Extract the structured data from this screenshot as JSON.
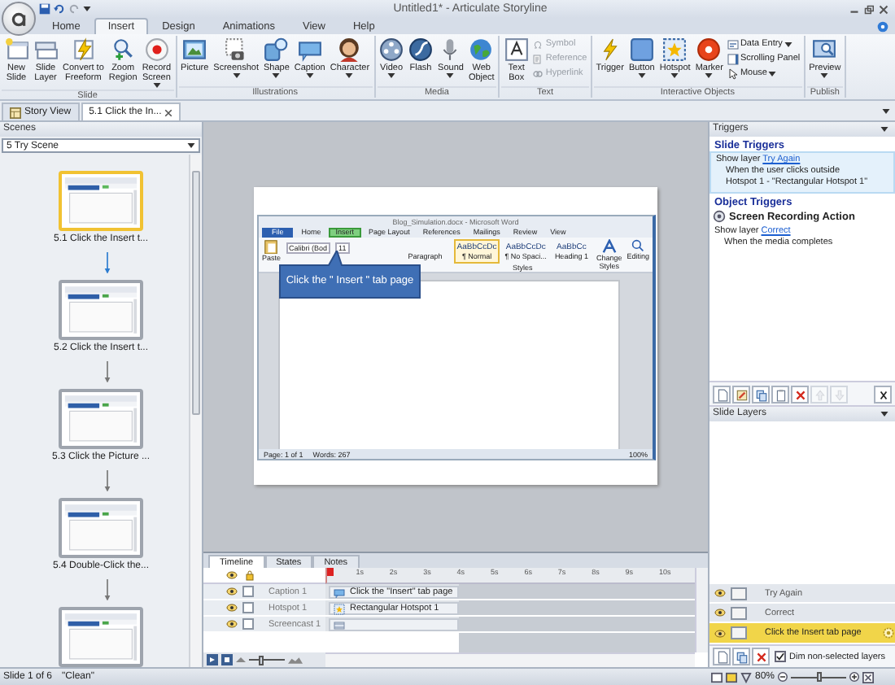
{
  "window": {
    "title": "Untitled1* - Articulate Storyline"
  },
  "ribbon": {
    "tabs": [
      {
        "label": "Home",
        "selected": false
      },
      {
        "label": "Insert",
        "selected": true
      },
      {
        "label": "Design",
        "selected": false
      },
      {
        "label": "Animations",
        "selected": false
      },
      {
        "label": "View",
        "selected": false
      },
      {
        "label": "Help",
        "selected": false
      }
    ],
    "groups": [
      {
        "label": "Slide",
        "items": [
          {
            "kind": "large",
            "label": "New\nSlide",
            "dropdown": false,
            "disabled": false
          },
          {
            "kind": "large",
            "label": "Slide\nLayer",
            "dropdown": false,
            "disabled": false
          },
          {
            "kind": "large",
            "label": "Convert to\nFreeform",
            "dropdown": false,
            "disabled": false
          },
          {
            "kind": "large",
            "label": "Zoom\nRegion",
            "dropdown": false,
            "disabled": false
          },
          {
            "kind": "large",
            "label": "Record\nScreen",
            "dropdown": true,
            "disabled": false
          }
        ]
      },
      {
        "label": "Illustrations",
        "items": [
          {
            "kind": "large",
            "label": "Picture",
            "dropdown": false,
            "disabled": false
          },
          {
            "kind": "large",
            "label": "Screenshot",
            "dropdown": true,
            "disabled": false
          },
          {
            "kind": "large",
            "label": "Shape",
            "dropdown": true,
            "disabled": false
          },
          {
            "kind": "large",
            "label": "Caption",
            "dropdown": true,
            "disabled": false
          },
          {
            "kind": "large",
            "label": "Character",
            "dropdown": true,
            "disabled": false
          }
        ]
      },
      {
        "label": "Media",
        "items": [
          {
            "kind": "large",
            "label": "Video",
            "dropdown": true,
            "disabled": false
          },
          {
            "kind": "large",
            "label": "Flash",
            "dropdown": false,
            "disabled": false
          },
          {
            "kind": "large",
            "label": "Sound",
            "dropdown": true,
            "disabled": false
          },
          {
            "kind": "large",
            "label": "Web\nObject",
            "dropdown": false,
            "disabled": false
          }
        ]
      },
      {
        "label": "Text",
        "items": [
          {
            "kind": "large",
            "label": "Text\nBox",
            "dropdown": false,
            "disabled": false
          },
          {
            "kind": "small",
            "label": "Symbol",
            "dropdown": false,
            "disabled": true
          },
          {
            "kind": "small",
            "label": "Reference",
            "dropdown": false,
            "disabled": true
          },
          {
            "kind": "small",
            "label": "Hyperlink",
            "dropdown": false,
            "disabled": true
          }
        ]
      },
      {
        "label": "Interactive Objects",
        "items": [
          {
            "kind": "large",
            "label": "Trigger",
            "dropdown": false,
            "disabled": false
          },
          {
            "kind": "large",
            "label": "Button",
            "dropdown": true,
            "disabled": false
          },
          {
            "kind": "large",
            "label": "Hotspot",
            "dropdown": true,
            "disabled": false
          },
          {
            "kind": "large",
            "label": "Marker",
            "dropdown": true,
            "disabled": false
          },
          {
            "kind": "small",
            "label": "Data Entry",
            "dropdown": true,
            "disabled": false
          },
          {
            "kind": "small",
            "label": "Scrolling Panel",
            "dropdown": false,
            "disabled": false
          },
          {
            "kind": "small",
            "label": "Mouse",
            "dropdown": true,
            "disabled": false
          }
        ]
      },
      {
        "label": "Publish",
        "items": [
          {
            "kind": "large",
            "label": "Preview",
            "dropdown": true,
            "disabled": false
          }
        ]
      }
    ]
  },
  "doc_tabs": [
    {
      "label": "Story View",
      "selected": false,
      "closable": false
    },
    {
      "label": "5.1 Click the In...",
      "selected": true,
      "closable": true
    }
  ],
  "scenes": {
    "title": "Scenes",
    "scene_select": "5 Try Scene",
    "slides": [
      {
        "label": "5.1 Click the Insert t...",
        "selected": true
      },
      {
        "label": "5.2 Click the Insert t...",
        "selected": false
      },
      {
        "label": "5.3 Click the Picture ...",
        "selected": false
      },
      {
        "label": "5.4 Double-Click the...",
        "selected": false
      },
      {
        "selected": false
      }
    ]
  },
  "slide": {
    "screenshot": {
      "title": "Blog_Simulation.docx - Microsoft Word",
      "tabs": [
        {
          "label": "File",
          "kind": "file",
          "highlighted": false
        },
        {
          "label": "Home",
          "kind": "tab",
          "highlighted": false
        },
        {
          "label": "Insert",
          "kind": "tab",
          "highlighted": true
        },
        {
          "label": "Page Layout",
          "kind": "tab",
          "highlighted": false
        },
        {
          "label": "References",
          "kind": "tab",
          "highlighted": false
        },
        {
          "label": "Mailings",
          "kind": "tab",
          "highlighted": false
        },
        {
          "label": "Review",
          "kind": "tab",
          "highlighted": false
        },
        {
          "label": "View",
          "kind": "tab",
          "highlighted": false
        }
      ],
      "paste": "Paste",
      "font": "Calibri (Bod",
      "font_size": "11",
      "styles": [
        {
          "sample": "AaBbCcDc",
          "name": "¶ Normal",
          "selected": true
        },
        {
          "sample": "AaBbCcDc",
          "name": "¶ No Spaci...",
          "selected": false
        },
        {
          "sample": "AaBbCc",
          "name": "Heading 1",
          "selected": false
        }
      ],
      "change_styles": "Change\nStyles",
      "editing": "Editing",
      "group_labels": [
        "Paragraph",
        "Styles"
      ],
      "status": [
        "Page: 1 of 1",
        "Words: 267"
      ],
      "zoom": "100%"
    },
    "callout": "Click the \" Insert \" tab page"
  },
  "timeline": {
    "tabs": [
      {
        "label": "Timeline",
        "selected": true
      },
      {
        "label": "States",
        "selected": false
      },
      {
        "label": "Notes",
        "selected": false
      }
    ],
    "ticks": [
      "1s",
      "2s",
      "3s",
      "4s",
      "5s",
      "6s",
      "7s",
      "8s",
      "9s",
      "10s"
    ],
    "rows": [
      {
        "name": "Caption 1",
        "bar": "Click the \"Insert\" tab page",
        "locked": false
      },
      {
        "name": "Hotspot 1",
        "bar": "Rectangular Hotspot 1",
        "locked": false
      },
      {
        "name": "Screencast 1",
        "locked": false
      }
    ],
    "zoom_slider": {
      "level": 0.35
    }
  },
  "triggers": {
    "title": "Triggers",
    "sections": [
      {
        "heading": "Slide Triggers",
        "items": [
          {
            "kind": "trigger",
            "action": "Show layer",
            "target": "Try Again",
            "lines": [
              "When the user clicks outside",
              "Hotspot 1 - \"Rectangular Hotspot 1\""
            ],
            "selected": true
          }
        ]
      },
      {
        "heading": "Object Triggers",
        "items": [
          {
            "kind": "object",
            "label": "Screen Recording Action",
            "selected": false
          },
          {
            "kind": "trigger",
            "action": "Show layer",
            "target": "Correct",
            "lines": [
              "When the media completes"
            ],
            "selected": false
          }
        ]
      }
    ],
    "toolbar": [
      {
        "disabled": false
      },
      {
        "disabled": false
      },
      {
        "disabled": false
      },
      {
        "disabled": false
      },
      {
        "disabled": false
      },
      {
        "disabled": true
      },
      {
        "disabled": true
      },
      {
        "disabled": false
      }
    ]
  },
  "layers": {
    "title": "Slide Layers",
    "items": [
      {
        "label": "Try Again",
        "selected": false
      },
      {
        "label": "Correct",
        "selected": false
      },
      {
        "label": "Click the Insert tab page",
        "selected": true
      }
    ],
    "dim": {
      "label": "Dim non-selected layers",
      "checked": true
    }
  },
  "status_bar": {
    "slide": "Slide 1 of 6",
    "theme": "\"Clean\"",
    "zoom": "80%",
    "zoom_slider": {
      "level": 0.5
    }
  }
}
